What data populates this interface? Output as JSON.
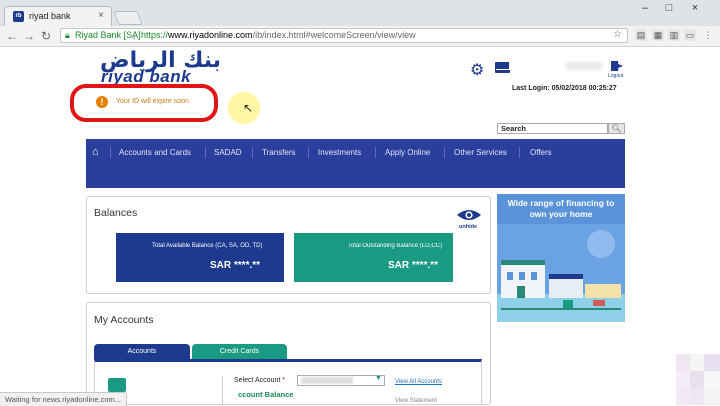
{
  "browser": {
    "tab_title": "riyad bank",
    "tab_close": "×",
    "favicon_text": "rb",
    "window_controls": [
      "–",
      "□",
      "×"
    ],
    "secure_label": "Riyad Bank [SA]",
    "url_scheme": "https://",
    "url_domain": "www.riyadonline.com",
    "url_path": "/ib/index.html#welcomeScreen/view/view",
    "status_text": "Waiting for news.riyadonline.com..."
  },
  "header": {
    "logo_arabic": "بنك الرياض",
    "logo_english": "riyad bank",
    "alert_text": "Your ID will expire soon",
    "logout_label": "Logout",
    "last_login": "Last Login: 05/02/2018 00:25:27",
    "search_label": "Search"
  },
  "nav": {
    "items": [
      "Accounts and Cards",
      "SADAD",
      "Transfers",
      "Investments",
      "Apply Online",
      "Other Services",
      "Offers"
    ]
  },
  "balances": {
    "title": "Balances",
    "unhide_label": "unhide",
    "available_label": "Total Available Balance (CA, SA, OD, TD)",
    "available_value": "SAR ****.**",
    "outstanding_label": "Total Outstanding Balance (LO,CC)",
    "outstanding_value": "SAR ****.**"
  },
  "ad": {
    "text": "Wide range of financing to own your home"
  },
  "accounts": {
    "title": "My Accounts",
    "tab_accounts": "Accounts",
    "tab_cards": "Credit Cards",
    "select_label": "Select Account",
    "select_required": "*",
    "view_all": "View All Accounts",
    "balance_label": "ccount Balance",
    "view_statement": "View Statement"
  },
  "colors": {
    "brand_blue": "#1d3a8e",
    "nav_blue": "#2a3e9b",
    "teal": "#1a9a82",
    "alert_orange": "#e67e00",
    "annotation_red": "#e01515"
  }
}
